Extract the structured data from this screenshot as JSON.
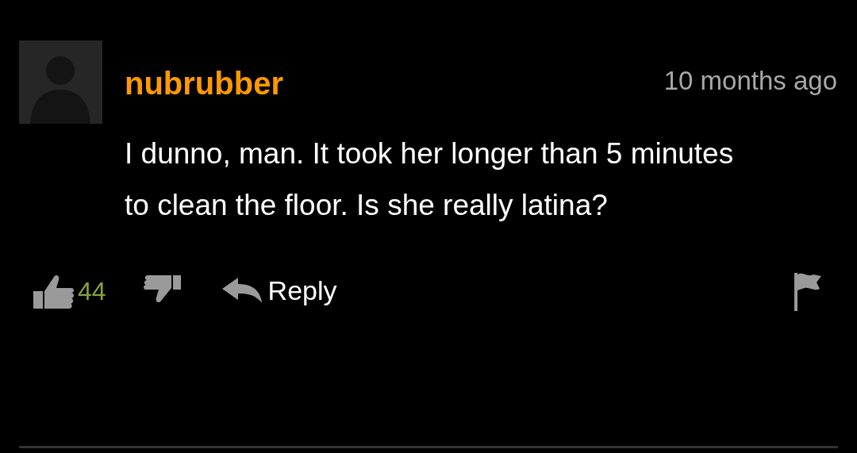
{
  "comment": {
    "username": "nubrubber",
    "time": "10 months ago",
    "text": "I dunno, man. It took her longer than 5 minutes to clean the floor. Is she really latina?",
    "likes": "44",
    "reply_label": "Reply"
  }
}
